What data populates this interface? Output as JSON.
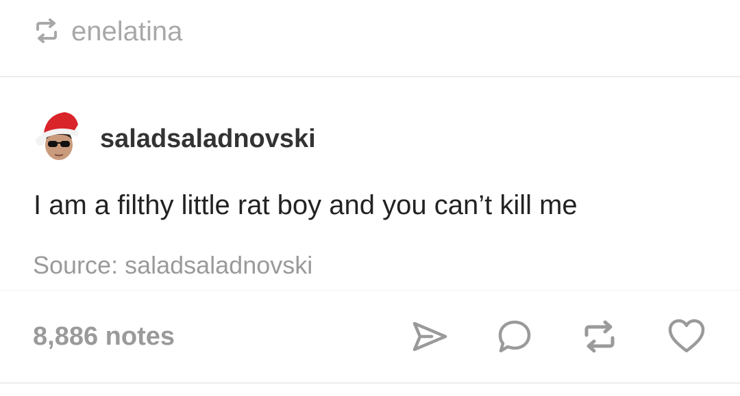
{
  "reblog": {
    "username": "enelatina",
    "icon": "reblog-icon"
  },
  "post": {
    "author": "saladsaladnovski",
    "avatar_icon": "santa-hat-avatar",
    "body": "I am a filthy little rat boy and you can’t kill me",
    "source_label": "Source: ",
    "source_name": "saladsaladnovski"
  },
  "footer": {
    "notes": "8,886 notes",
    "actions": [
      "share-icon",
      "reply-icon",
      "reblog-icon",
      "heart-icon"
    ]
  },
  "colors": {
    "muted_text": "#a8a8a8",
    "body_text": "#222222",
    "username_text": "#333333",
    "icon_stroke": "#9a9a9a"
  }
}
